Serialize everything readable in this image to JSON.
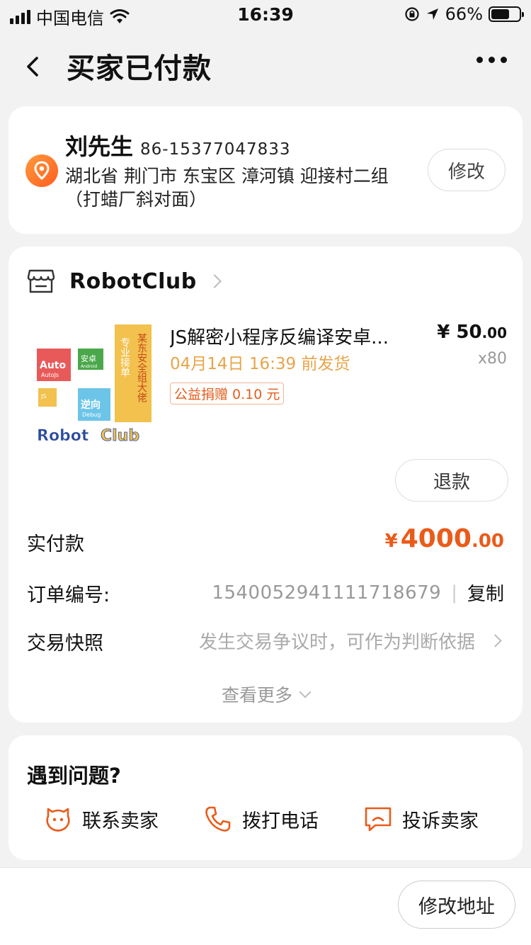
{
  "status_bar": {
    "carrier": "中国电信",
    "time": "16:39",
    "battery": "66%",
    "battery_level": 0.66
  },
  "nav": {
    "title": "买家已付款",
    "back_icon": "chevron-left-icon",
    "more_icon": "more-dots-icon"
  },
  "address": {
    "name": "刘先生",
    "phone": "86-15377047833",
    "line": "湖北省 荆门市 东宝区 漳河镇 迎接村二组（打蜡厂斜对面）",
    "edit_label": "修改",
    "icon": "location-pin-icon"
  },
  "order": {
    "shop_name": "RobotClub",
    "product": {
      "title": "JS解密小程序反编译安卓...",
      "ship_date": "04月14日 16:39 前发货",
      "charity": "公益捐赠 0.10 元",
      "price_currency": "¥",
      "price_int": "50",
      "price_dec": ".00",
      "qty": "x80",
      "image_text": {
        "brand_left": "Robot",
        "brand_right": "Club",
        "auto": "Auto",
        "autojs": "AutoJs",
        "anzhuo": "安卓",
        "android": "Android",
        "js": "JS",
        "nixiang": "逆向",
        "debug": "Debug",
        "zhuanye": "专业接单",
        "mou": "某东安全组大佬"
      }
    },
    "refund_label": "退款",
    "paid_label": "实付款",
    "paid_currency": "¥",
    "paid_int": "4000",
    "paid_dec": ".00",
    "order_no_label": "订单编号:",
    "order_no": "1540052941111718679",
    "copy_label": "复制",
    "snapshot_label": "交易快照",
    "snapshot_hint": "发生交易争议时，可作为判断依据",
    "more_label": "查看更多"
  },
  "problems": {
    "title": "遇到问题?",
    "actions": [
      {
        "label": "联系卖家",
        "icon": "chat-face-icon"
      },
      {
        "label": "拨打电话",
        "icon": "phone-icon"
      },
      {
        "label": "投诉卖家",
        "icon": "complaint-icon"
      }
    ]
  },
  "bottom": {
    "change_address_label": "修改地址"
  },
  "colors": {
    "accent": "#ea5b1a",
    "ship_date": "#e8a44a",
    "background": "#f2f2f2"
  }
}
